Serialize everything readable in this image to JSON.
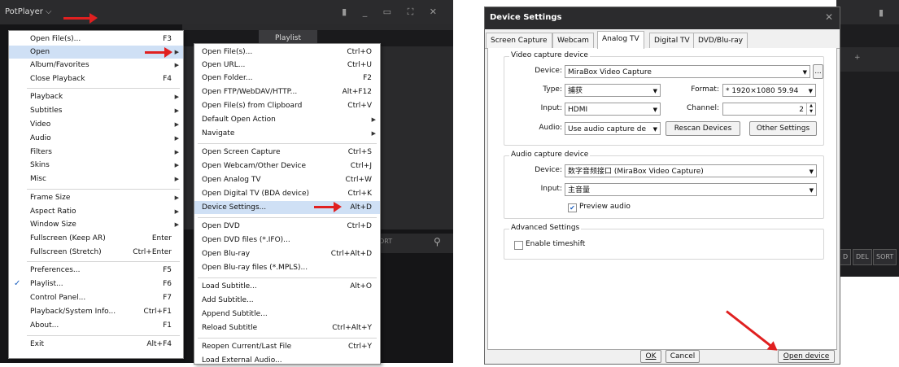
{
  "potplayer": {
    "brand": "PotPlayer",
    "window_buttons": "▮ _ ▭ ⛶ ✕",
    "playlist_tab": "Playlist",
    "sort_label": "ORT"
  },
  "main_menu": [
    {
      "label": "Open File(s)...",
      "shortcut": "F3"
    },
    {
      "label": "Open",
      "shortcut": "",
      "submenu": true,
      "highlighted": true
    },
    {
      "label": "Album/Favorites",
      "shortcut": "",
      "submenu": true
    },
    {
      "label": "Close Playback",
      "shortcut": "F4"
    },
    {
      "label": "Playback",
      "shortcut": "",
      "submenu": true
    },
    {
      "label": "Subtitles",
      "shortcut": "",
      "submenu": true
    },
    {
      "label": "Video",
      "shortcut": "",
      "submenu": true
    },
    {
      "label": "Audio",
      "shortcut": "",
      "submenu": true
    },
    {
      "label": "Filters",
      "shortcut": "",
      "submenu": true
    },
    {
      "label": "Skins",
      "shortcut": "",
      "submenu": true
    },
    {
      "label": "Misc",
      "shortcut": "",
      "submenu": true
    },
    {
      "label": "Frame Size",
      "shortcut": "",
      "submenu": true
    },
    {
      "label": "Aspect Ratio",
      "shortcut": "",
      "submenu": true
    },
    {
      "label": "Window Size",
      "shortcut": "",
      "submenu": true
    },
    {
      "label": "Fullscreen (Keep AR)",
      "shortcut": "Enter"
    },
    {
      "label": "Fullscreen (Stretch)",
      "shortcut": "Ctrl+Enter"
    },
    {
      "label": "Preferences...",
      "shortcut": "F5"
    },
    {
      "label": "Playlist...",
      "shortcut": "F6",
      "checked": true
    },
    {
      "label": "Control Panel...",
      "shortcut": "F7"
    },
    {
      "label": "Playback/System Info...",
      "shortcut": "Ctrl+F1"
    },
    {
      "label": "About...",
      "shortcut": "F1"
    },
    {
      "label": "Exit",
      "shortcut": "Alt+F4"
    }
  ],
  "open_submenu": [
    {
      "label": "Open File(s)...",
      "shortcut": "Ctrl+O"
    },
    {
      "label": "Open URL...",
      "shortcut": "Ctrl+U"
    },
    {
      "label": "Open Folder...",
      "shortcut": "F2"
    },
    {
      "label": "Open FTP/WebDAV/HTTP...",
      "shortcut": "Alt+F12"
    },
    {
      "label": "Open File(s) from Clipboard",
      "shortcut": "Ctrl+V"
    },
    {
      "label": "Default Open Action",
      "shortcut": "",
      "submenu": true
    },
    {
      "label": "Navigate",
      "shortcut": "",
      "submenu": true
    },
    {
      "label": "Open Screen Capture",
      "shortcut": "Ctrl+S"
    },
    {
      "label": "Open Webcam/Other Device",
      "shortcut": "Ctrl+J"
    },
    {
      "label": "Open Analog TV",
      "shortcut": "Ctrl+W"
    },
    {
      "label": "Open Digital TV (BDA device)",
      "shortcut": "Ctrl+K"
    },
    {
      "label": "Device Settings...",
      "shortcut": "Alt+D",
      "highlighted": true
    },
    {
      "label": "Open DVD",
      "shortcut": "Ctrl+D"
    },
    {
      "label": "Open DVD files (*.IFO)...",
      "shortcut": ""
    },
    {
      "label": "Open Blu-ray",
      "shortcut": "Ctrl+Alt+D"
    },
    {
      "label": "Open Blu-ray files (*.MPLS)...",
      "shortcut": ""
    },
    {
      "label": "Load Subtitle...",
      "shortcut": "Alt+O"
    },
    {
      "label": "Add Subtitle...",
      "shortcut": ""
    },
    {
      "label": "Append Subtitle...",
      "shortcut": ""
    },
    {
      "label": "Reload Subtitle",
      "shortcut": "Ctrl+Alt+Y"
    },
    {
      "label": "Reopen Current/Last File",
      "shortcut": "Ctrl+Y"
    },
    {
      "label": "Load External Audio...",
      "shortcut": ""
    }
  ],
  "device_settings": {
    "title": "Device Settings",
    "close": "✕",
    "tabs": [
      "Screen Capture",
      "Webcam",
      "Analog TV",
      "Digital TV",
      "DVD/Blu-ray"
    ],
    "active_tab": "Analog TV",
    "video_group": {
      "title": "Video capture device",
      "device_label": "Device:",
      "device_value": "MiraBox Video Capture",
      "browse": "...",
      "type_label": "Type:",
      "type_value": "捕获",
      "format_label": "Format:",
      "format_value": "* 1920×1080 59.94",
      "input_label": "Input:",
      "input_value": "HDMI",
      "channel_label": "Channel:",
      "channel_value": "2",
      "audio_label": "Audio:",
      "audio_value": "Use audio capture de",
      "rescan": "Rescan Devices",
      "other": "Other Settings"
    },
    "audio_group": {
      "title": "Audio capture device",
      "device_label": "Device:",
      "device_value": "数字音频接口 (MiraBox Video Capture)",
      "input_label": "Input:",
      "input_value": "主音量",
      "preview_label": "Preview audio",
      "preview_checked": true
    },
    "advanced_group": {
      "title": "Advanced Settings",
      "timeshift_label": "Enable timeshift",
      "timeshift_checked": false
    },
    "ok": "OK",
    "cancel": "Cancel",
    "open_device": "Open device"
  },
  "back_window": {
    "pin": "▮",
    "plus": "+",
    "buttons": [
      "D",
      "DEL",
      "SORT"
    ]
  }
}
